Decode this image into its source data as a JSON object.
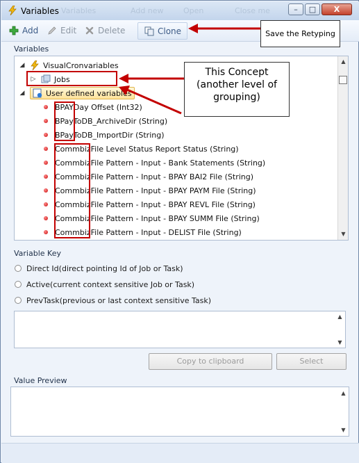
{
  "window": {
    "title": "Variables",
    "ghost_labels": [
      "Variables",
      "Add new",
      "Open",
      "Close me"
    ],
    "controls": {
      "minimize": "–",
      "maximize": "□",
      "close": "X"
    }
  },
  "toolbar": {
    "add_label": "Add",
    "edit_label": "Edit",
    "delete_label": "Delete",
    "clone_label": "Clone"
  },
  "annotations": {
    "callout_top": "Save the Retyping",
    "callout_middle": "This Concept (another level of grouping)",
    "arrow_color": "#c30000"
  },
  "variables_panel": {
    "label": "Variables",
    "tree": [
      {
        "label": "VisualCronvariables",
        "level": 0,
        "expander": "◢",
        "icon": "visualcron-icon"
      },
      {
        "label": "Jobs",
        "level": 1,
        "expander": "▷",
        "icon": "jobs-icon"
      },
      {
        "label": "User defined variables",
        "level": 0,
        "expander": "◢",
        "icon": "user-variables-icon",
        "selected": true
      }
    ],
    "items": [
      {
        "prefix": "BPAY",
        "rest": " Day Offset (Int32)"
      },
      {
        "prefix": "BPayToDB",
        "rest": "_ArchiveDir (String)"
      },
      {
        "prefix": "BPayToDB",
        "rest": "_ImportDir (String)"
      },
      {
        "prefix": "Commbiz",
        "rest": " File Level Status Report Status (String)"
      },
      {
        "prefix": "Commbiz",
        "rest": " File Pattern - Input - Bank Statements (String)"
      },
      {
        "prefix": "Commbiz",
        "rest": " File Pattern - Input - BPAY BAI2 File (String)"
      },
      {
        "prefix": "Commbiz",
        "rest": " File Pattern - Input - BPAY PAYM File (String)"
      },
      {
        "prefix": "Commbiz",
        "rest": " File Pattern - Input - BPAY REVL File (String)"
      },
      {
        "prefix": "Commbiz",
        "rest": " File Pattern - Input - BPAY SUMM File (String)"
      },
      {
        "prefix": "Commbiz",
        "rest": " File Pattern - Input - DELIST File (String)"
      }
    ]
  },
  "variable_key": {
    "label": "Variable Key",
    "options": [
      {
        "name": "Direct Id",
        "desc": " (direct pointing Id of Job or Task)"
      },
      {
        "name": "Active",
        "desc": " (current context sensitive Job or Task)"
      },
      {
        "name": "PrevTask",
        "desc": " (previous or last context sensitive Task)"
      }
    ],
    "copy_label": "Copy to clipboard",
    "select_label": "Select"
  },
  "value_preview": {
    "label": "Value Preview"
  }
}
